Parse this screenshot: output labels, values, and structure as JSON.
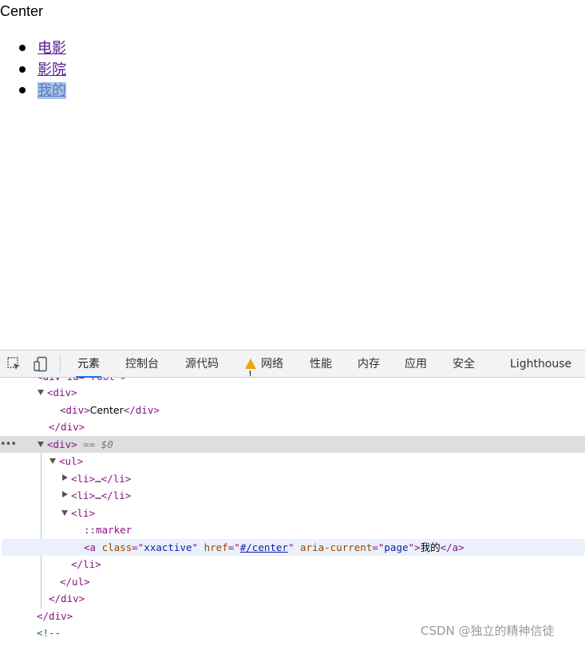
{
  "page": {
    "heading_text": "Center",
    "nav_items": [
      {
        "label": "电影"
      },
      {
        "label": "影院"
      },
      {
        "label": "我的",
        "active": true
      }
    ]
  },
  "devtools": {
    "tabs": [
      {
        "label": "元素",
        "selected": true
      },
      {
        "label": "控制台"
      },
      {
        "label": "源代码"
      },
      {
        "label": "网络",
        "warning": true
      },
      {
        "label": "性能"
      },
      {
        "label": "内存"
      },
      {
        "label": "应用"
      },
      {
        "label": "安全"
      },
      {
        "label": "Lighthouse"
      }
    ],
    "tree": {
      "partial_top": "<div id=\"root\">",
      "div_open": "div",
      "center_text": "Center",
      "selected_marker": "== $0",
      "marker": "::marker",
      "ellipsis": "…",
      "anchor": {
        "class_name": "class",
        "class_value": "xxactive",
        "href_name": "href",
        "href_value": "#/center",
        "aria_name": "aria-current",
        "aria_value": "page",
        "text": "我的"
      },
      "comment_start": "<!--"
    }
  },
  "watermark": "CSDN @独立的精神信徒",
  "colors": {
    "tag": "#881280",
    "attr_name": "#994500",
    "attr_value": "#1a1aa6",
    "selected_row": "#dedede",
    "tab_underline": "#1a73e8"
  }
}
